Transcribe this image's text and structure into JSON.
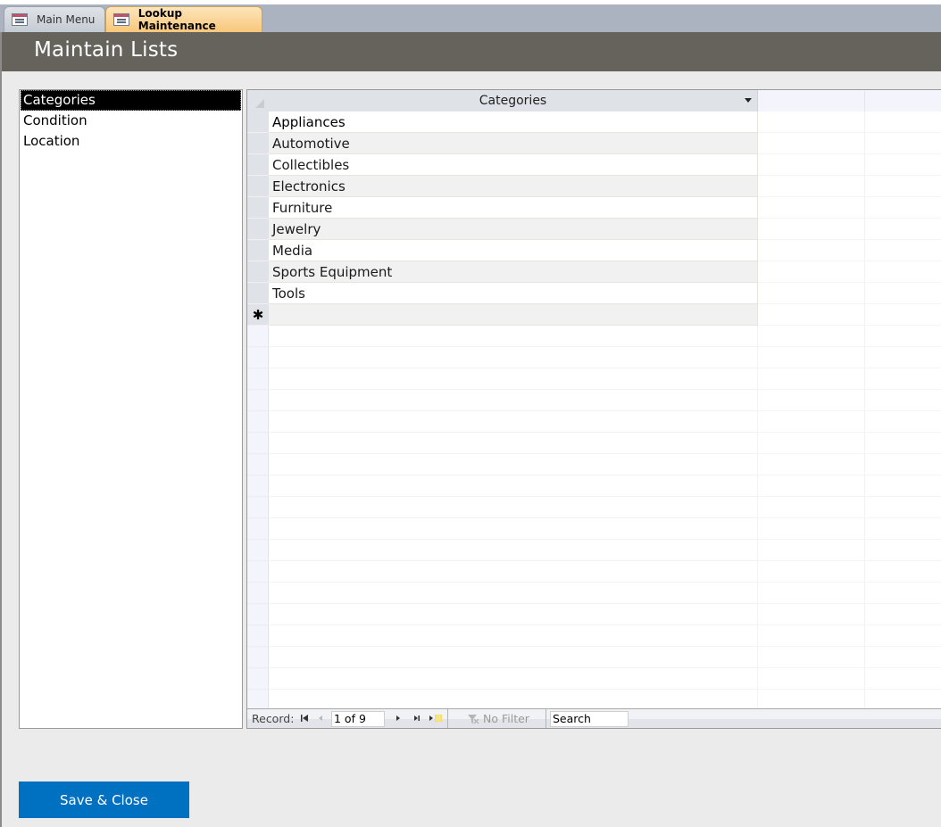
{
  "tabs": [
    {
      "label": "Main Menu",
      "icon": "form-icon",
      "active": false
    },
    {
      "label": "Lookup Maintenance",
      "icon": "form-icon",
      "active": true
    }
  ],
  "header": {
    "title": "Maintain Lists"
  },
  "list": {
    "items": [
      {
        "label": "Categories",
        "selected": true
      },
      {
        "label": "Condition",
        "selected": false
      },
      {
        "label": "Location",
        "selected": false
      }
    ]
  },
  "datasheet": {
    "column_header": "Categories",
    "rows": [
      "Appliances",
      "Automotive",
      "Collectibles",
      "Electronics",
      "Furniture",
      "Jewelry",
      "Media",
      "Sports Equipment",
      "Tools"
    ],
    "new_record_marker": "✱"
  },
  "navigation": {
    "record_label": "Record:",
    "current": "1 of 9",
    "filter_label": "No Filter",
    "search_placeholder": "Search"
  },
  "actions": {
    "save_close_label": "Save & Close"
  },
  "colors": {
    "header_bg": "#66625c",
    "active_tab": "#f8c77a",
    "button_bg": "#0070c0",
    "selected_item_bg": "#000000"
  }
}
